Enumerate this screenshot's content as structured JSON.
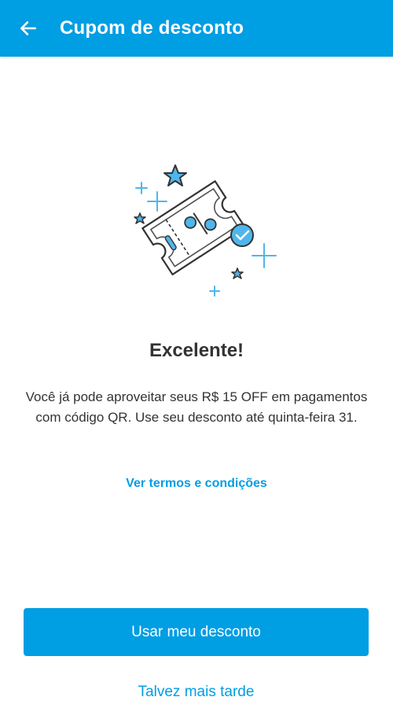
{
  "header": {
    "title": "Cupom de desconto",
    "back_icon": "arrow-left-icon",
    "background_color": "#009ee3"
  },
  "main": {
    "illustration_icon": "discount-coupon-ticket-icon",
    "headline": "Excelente!",
    "description": "Você já pode aproveitar seus R$ 15 OFF em pagamentos com código QR. Use seu desconto até quinta-feira 31.",
    "terms_link": "Ver termos e condições"
  },
  "actions": {
    "primary_label": "Usar meu desconto",
    "secondary_label": "Talvez mais tarde"
  },
  "colors": {
    "accent": "#009ee3",
    "illustration_blue": "#4fb6ec",
    "outline": "#333333"
  }
}
